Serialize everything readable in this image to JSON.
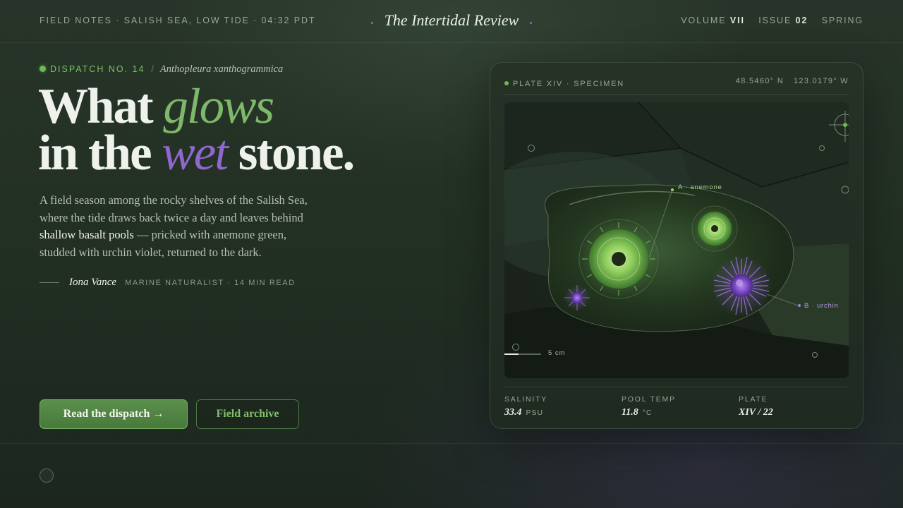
{
  "topbar": {
    "field_notes": "FIELD NOTES · SALISH SEA, LOW TIDE · 04:32 PDT",
    "masthead": "The Intertidal Review",
    "volume_label": "VOLUME",
    "volume_value": "VII",
    "issue_label": "ISSUE",
    "issue_value": "02",
    "season": "SPRING"
  },
  "hero": {
    "dispatch_label": "DISPATCH NO. 14",
    "separator": "/",
    "species": "Anthopleura xanthogrammica",
    "headline": {
      "w1": "What",
      "w2": "glows",
      "w3": "in the",
      "w4": "wet",
      "w5": "stone."
    },
    "lede_1": "A field season among the rocky shelves of the Salish Sea, where the tide draws back twice a day and leaves behind",
    "lede_strong": "shallow basalt pools",
    "lede_2": "— pricked with anemone green, studded with urchin violet, returned to the dark.",
    "author": "Iona Vance",
    "author_meta": "MARINE NATURALIST · 14 MIN READ",
    "primary_button": "Read the dispatch →",
    "secondary_button": "Field archive"
  },
  "card": {
    "plate_label": "PLATE XIV · SPECIMEN",
    "lat": "48.5460° N",
    "lon": "123.0179° W",
    "label_a": "A · anemone",
    "label_b": "B · urchin",
    "scale_label": "5 cm",
    "stats": [
      {
        "key": "SALINITY",
        "value": "33.4",
        "unit": "PSU"
      },
      {
        "key": "POOL TEMP",
        "value": "11.8",
        "unit": "°C"
      },
      {
        "key": "PLATE",
        "value": "XIV / 22",
        "unit": ""
      }
    ]
  },
  "colors": {
    "accent_green": "#7fb86a",
    "accent_violet": "#9066cf",
    "background": "#243125"
  }
}
